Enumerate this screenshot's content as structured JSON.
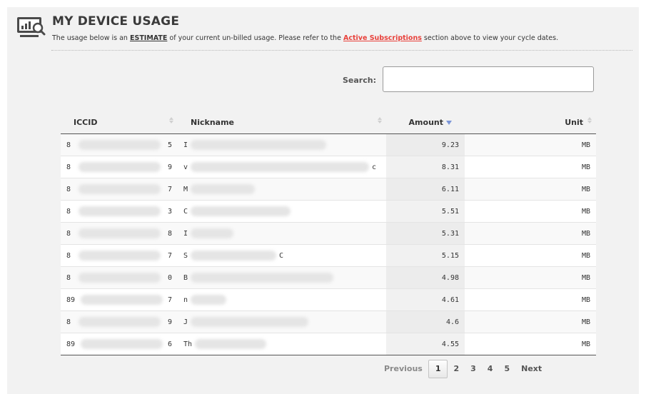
{
  "header": {
    "title": "MY DEVICE USAGE",
    "subtitle_prefix": "The usage below is an",
    "subtitle_emph": "ESTIMATE",
    "subtitle_mid": "of your current un-billed usage. Please refer to the",
    "subtitle_link": "Active Subscriptions",
    "subtitle_suffix": "section above to view your cycle dates."
  },
  "search": {
    "label": "Search:",
    "value": "",
    "placeholder": ""
  },
  "table": {
    "columns": [
      "ICCID",
      "Nickname",
      "Amount",
      "Unit"
    ],
    "sorted_column": "Amount",
    "sort_direction": "descending",
    "rows": [
      {
        "iccid_start": "8",
        "iccid_end": "5",
        "nick_start": "I",
        "nick_end": "",
        "amount": "9.23",
        "unit": "MB"
      },
      {
        "iccid_start": "8",
        "iccid_end": "9",
        "nick_start": "v",
        "nick_end": "c",
        "amount": "8.31",
        "unit": "MB"
      },
      {
        "iccid_start": "8",
        "iccid_end": "7",
        "nick_start": "M",
        "nick_end": "",
        "amount": "6.11",
        "unit": "MB"
      },
      {
        "iccid_start": "8",
        "iccid_end": "3",
        "nick_start": "C",
        "nick_end": "",
        "amount": "5.51",
        "unit": "MB"
      },
      {
        "iccid_start": "8",
        "iccid_end": "8",
        "nick_start": "I",
        "nick_end": "",
        "amount": "5.31",
        "unit": "MB"
      },
      {
        "iccid_start": "8",
        "iccid_end": "7",
        "nick_start": "S",
        "nick_end": "C",
        "amount": "5.15",
        "unit": "MB"
      },
      {
        "iccid_start": "8",
        "iccid_end": "0",
        "nick_start": "B",
        "nick_end": "",
        "amount": "4.98",
        "unit": "MB"
      },
      {
        "iccid_start": "89",
        "iccid_end": "7",
        "nick_start": "n",
        "nick_end": "",
        "amount": "4.61",
        "unit": "MB"
      },
      {
        "iccid_start": "8",
        "iccid_end": "9",
        "nick_start": "J",
        "nick_end": "",
        "amount": "4.6",
        "unit": "MB"
      },
      {
        "iccid_start": "89",
        "iccid_end": "6",
        "nick_start": "Th",
        "nick_end": "",
        "amount": "4.55",
        "unit": "MB"
      }
    ]
  },
  "pagination": {
    "previous": "Previous",
    "pages": [
      "1",
      "2",
      "3",
      "4",
      "5"
    ],
    "current_page": "1",
    "next": "Next"
  },
  "icons": {
    "header_icon": "device-usage-monitor-icon",
    "sort_icon": "sort-arrows-icon",
    "active_sort_icon": "sort-descending-icon"
  },
  "colors": {
    "link": "#e8413b",
    "sort_active": "#7c96d8",
    "panel_bg": "#f2f2f2"
  }
}
